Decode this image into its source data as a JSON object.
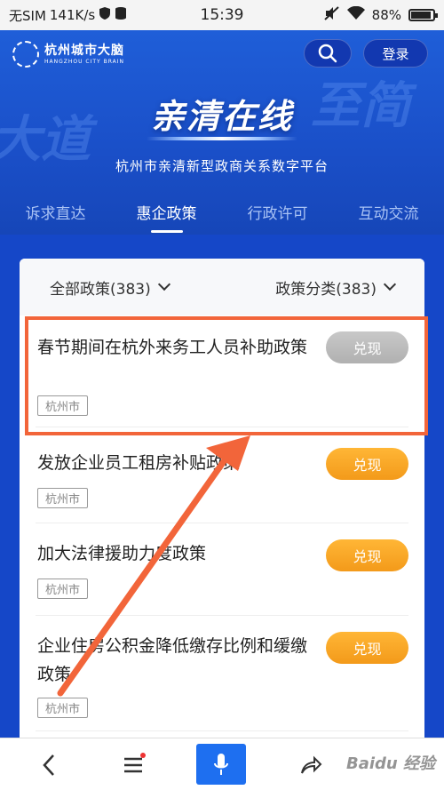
{
  "status_bar": {
    "carrier": "无SIM",
    "speed": "141K/s",
    "time": "15:39",
    "battery": "88%"
  },
  "header": {
    "logo_cn": "杭州城市大脑",
    "logo_en": "HANGZHOU CITY BRAIN",
    "login_label": "登录",
    "bg_word_left": "大道",
    "bg_word_right": "至简",
    "hero_title": "亲清在线",
    "hero_subtitle": "杭州市亲清新型政商关系数字平台"
  },
  "tabs": [
    {
      "label": "诉求直达"
    },
    {
      "label": "惠企政策"
    },
    {
      "label": "行政许可"
    },
    {
      "label": "互动交流"
    }
  ],
  "filters": {
    "all_policies": "全部政策(383)",
    "categories": "政策分类(383)"
  },
  "policies": [
    {
      "title": "春节期间在杭外来务工人员补助政策",
      "tag": "杭州市",
      "button": "兑现",
      "button_state": "disabled"
    },
    {
      "title": "发放企业员工租房补贴政策",
      "tag": "杭州市",
      "button": "兑现",
      "button_state": "active"
    },
    {
      "title": "加大法律援助力度政策",
      "tag": "杭州市",
      "button": "兑现",
      "button_state": "active"
    },
    {
      "title": "企业住房公积金降低缴存比例和缓缴政策",
      "tag": "杭州市",
      "button": "兑现",
      "button_state": "active"
    }
  ],
  "watermark": "Baidu 经验",
  "colors": {
    "brand_blue": "#1547c8",
    "accent_orange": "#f39a1a",
    "highlight_red": "#f2653a"
  }
}
